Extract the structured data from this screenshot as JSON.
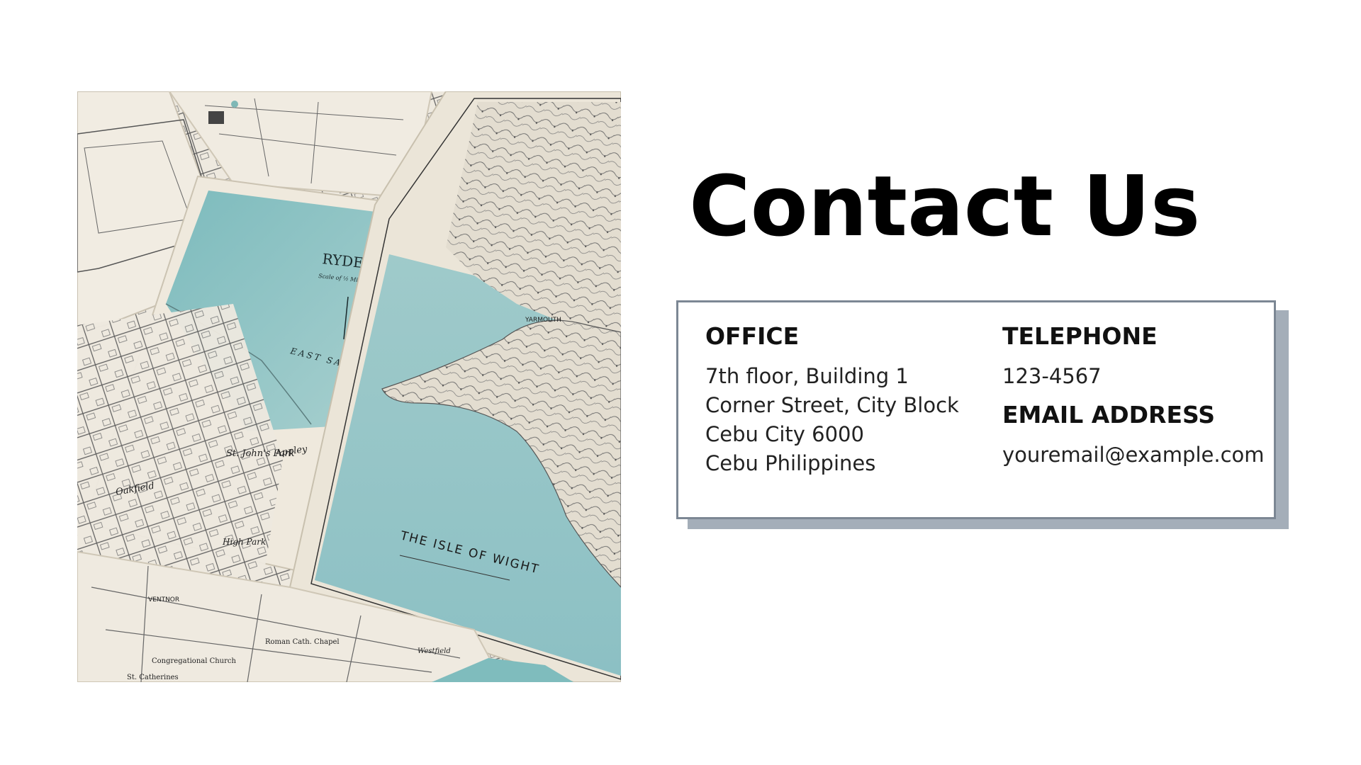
{
  "title": "Contact Us",
  "office": {
    "label": "OFFICE",
    "lines": [
      "7th floor, Building 1",
      "Corner Street, City Block",
      "Cebu City 6000",
      "Cebu Philippines"
    ]
  },
  "telephone": {
    "label": "TELEPHONE",
    "value": "123-4567"
  },
  "email": {
    "label": "EMAIL ADDRESS",
    "value": "youremail@example.com"
  },
  "map_text": {
    "ryde": "RYDE",
    "scale": "Scale of ½ Mile",
    "east_sands": "EAST SANDS",
    "isle_of_wight": "THE ISLE OF WIGHT",
    "appley": "Appley",
    "st_johns_park": "St. John's Park",
    "high_park": "High Park",
    "oakfield": "Oakfield",
    "yarmouth": "YARMOUTH",
    "ventnor": "VENTNOR",
    "st_catherines": "St. Catherines",
    "congregational_church": "Congregational Church",
    "roman_catholic": "Roman Cath. Chapel",
    "westfield": "Westfield"
  },
  "colors": {
    "sea": "#8fc3c4",
    "sea_dark": "#6fb0b2",
    "paper": "#ece6da",
    "card_border": "#7c8794",
    "card_shadow": "#a4aeb9"
  }
}
